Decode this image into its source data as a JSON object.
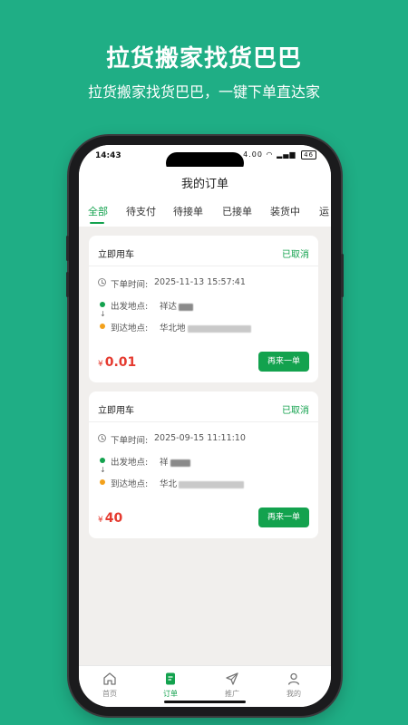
{
  "promo": {
    "title": "拉货搬家找货巴巴",
    "subtitle": "拉货搬家找货巴巴，一键下单直达家"
  },
  "status_bar": {
    "time": "14:43",
    "network": "4.00",
    "battery": "46"
  },
  "header": {
    "title": "我的订单"
  },
  "tabs": [
    {
      "label": "全部",
      "active": true
    },
    {
      "label": "待支付",
      "active": false
    },
    {
      "label": "待接单",
      "active": false
    },
    {
      "label": "已接单",
      "active": false
    },
    {
      "label": "装货中",
      "active": false
    },
    {
      "label": "运",
      "active": false
    }
  ],
  "orders": [
    {
      "type": "立即用车",
      "status": "已取消",
      "time_label": "下单时间:",
      "time": "2025-11-13 15:57:41",
      "from_label": "出发地点:",
      "from_value": "祥达",
      "to_label": "到达地点:",
      "to_value": "华北地",
      "price_symbol": "¥",
      "price": "0.01",
      "button_label": "再来一单"
    },
    {
      "type": "立即用车",
      "status": "已取消",
      "time_label": "下单时间:",
      "time": "2025-09-15 11:11:10",
      "from_label": "出发地点:",
      "from_value": "祥",
      "to_label": "到达地点:",
      "to_value": "华北",
      "price_symbol": "¥",
      "price": "40",
      "button_label": "再来一单"
    }
  ],
  "bottom_nav": [
    {
      "label": "首页",
      "icon": "home-icon",
      "active": false
    },
    {
      "label": "订单",
      "icon": "order-icon",
      "active": true
    },
    {
      "label": "推广",
      "icon": "paper-plane-icon",
      "active": false
    },
    {
      "label": "我的",
      "icon": "user-icon",
      "active": false
    }
  ],
  "colors": {
    "background": "#1fae85",
    "accent": "#13a24e",
    "price": "#e53a2f",
    "origin_dot": "#13a24e",
    "destination_dot": "#f3a11b"
  }
}
